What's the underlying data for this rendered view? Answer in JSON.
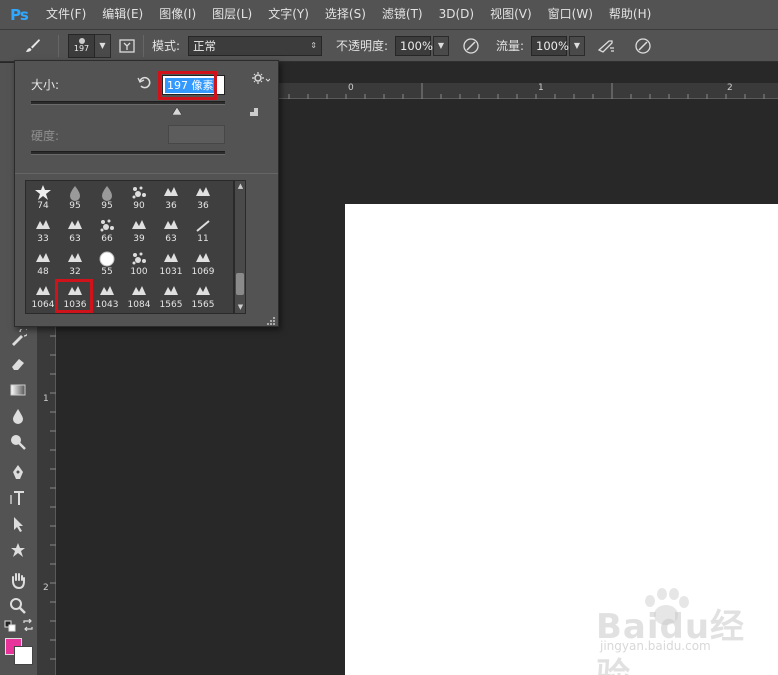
{
  "app": {
    "logo": "Ps"
  },
  "menu": [
    "文件(F)",
    "编辑(E)",
    "图像(I)",
    "图层(L)",
    "文字(Y)",
    "选择(S)",
    "滤镜(T)",
    "3D(D)",
    "视图(V)",
    "窗口(W)",
    "帮助(H)"
  ],
  "options": {
    "brush_size_badge": "197",
    "mode_label": "模式:",
    "mode_value": "正常",
    "opacity_label": "不透明度:",
    "opacity_value": "100%",
    "flow_label": "流量:",
    "flow_value": "100%"
  },
  "brush_panel": {
    "size_label": "大小:",
    "size_value": "197 像素",
    "size_fraction": 0.75,
    "hardness_label": "硬度:",
    "presets": [
      "74",
      "95",
      "95",
      "90",
      "36",
      "36",
      "33",
      "63",
      "66",
      "39",
      "63",
      "11",
      "48",
      "32",
      "55",
      "100",
      "1031",
      "1069",
      "1064",
      "1036",
      "1043",
      "1084",
      "1565",
      "1565"
    ],
    "selected_preset": "1036"
  },
  "rulers": {
    "top": [
      "0",
      "1",
      "2"
    ],
    "left": [
      "1",
      "2"
    ]
  },
  "colors": {
    "foreground": "#e8339a",
    "background": "#ffffff",
    "highlight": "#d0131a",
    "selection": "#3399ff"
  },
  "watermark": {
    "brand": "Baidu经验",
    "url": "jingyan.baidu.com"
  }
}
